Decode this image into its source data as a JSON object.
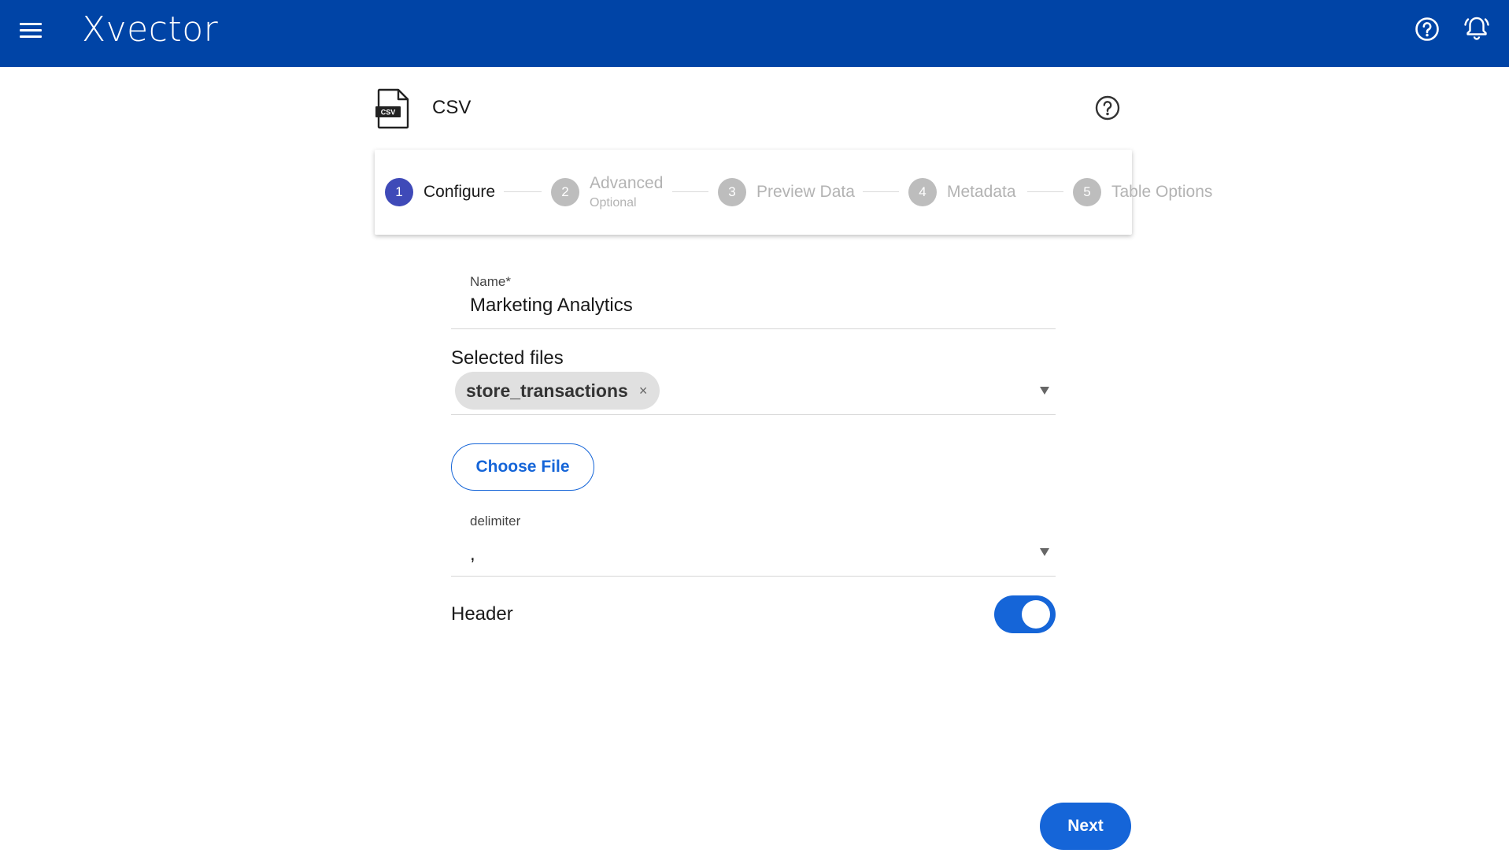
{
  "app": {
    "brand": "Xvector"
  },
  "page": {
    "title": "CSV",
    "file_badge": "CSV"
  },
  "stepper": {
    "steps": [
      {
        "number": "1",
        "label": "Configure",
        "sublabel": ""
      },
      {
        "number": "2",
        "label": "Advanced",
        "sublabel": "Optional"
      },
      {
        "number": "3",
        "label": "Preview Data",
        "sublabel": ""
      },
      {
        "number": "4",
        "label": "Metadata",
        "sublabel": ""
      },
      {
        "number": "5",
        "label": "Table Options",
        "sublabel": ""
      }
    ],
    "active_index": 0
  },
  "form": {
    "name_label": "Name*",
    "name_value": "Marketing Analytics",
    "files_label": "Selected files",
    "selected_files": [
      "store_transactions"
    ],
    "chip_remove": "×",
    "choose_file_label": "Choose File",
    "delimiter_label": "delimiter",
    "delimiter_value": ",",
    "header_label": "Header",
    "header_enabled": true
  },
  "footer": {
    "next_label": "Next"
  },
  "colors": {
    "topbar": "#0044a6",
    "primary": "#1565d8",
    "step_active": "#3f4ab8",
    "step_inactive": "#bdbdbd"
  }
}
